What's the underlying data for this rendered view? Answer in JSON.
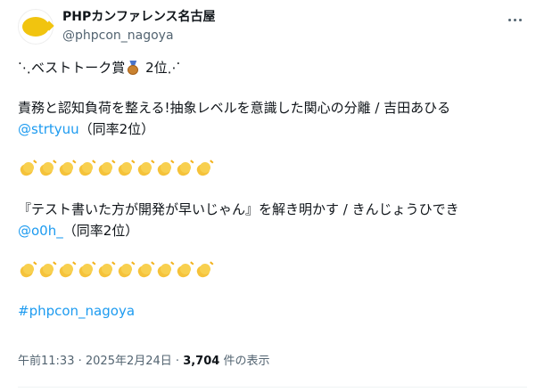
{
  "header": {
    "display_name": "PHPカンファレンス名古屋",
    "handle": "@phpcon_nagoya",
    "more_icon": "more-horizontal-icon"
  },
  "post": {
    "line1_pre": "⋱ベストトーク賞",
    "medal_icon": "bronze-medal-icon",
    "line1_post": " 2位⋰",
    "talk1_title": "責務と認知負荷を整える!抽象レベルを意識した関心の分離 / 吉田あひる",
    "talk1_mention": "@strtyuu",
    "talk1_rank": "（同率2位）",
    "clap_icon": "clapping-hands-icon",
    "clap_count": 10,
    "talk2_title": "『テスト書いた方が開発が早いじゃん』を解き明かす / きんじょうひでき",
    "talk2_mention": "@o0h_",
    "talk2_rank": "（同率2位）",
    "hashtag": "#phpcon_nagoya"
  },
  "meta": {
    "time": "午前11:33",
    "separator": " · ",
    "date": "2025年2月24日",
    "views_count": "3,704",
    "views_label": " 件の表示"
  }
}
